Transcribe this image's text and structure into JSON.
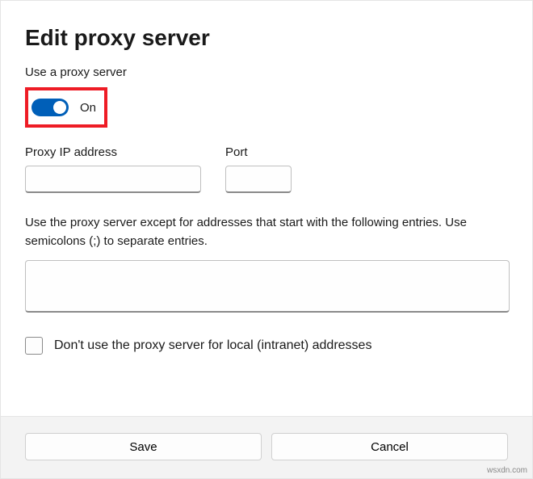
{
  "header": {
    "title": "Edit proxy server"
  },
  "toggle": {
    "label": "Use a proxy server",
    "state_label": "On"
  },
  "fields": {
    "ip_label": "Proxy IP address",
    "ip_value": "",
    "port_label": "Port",
    "port_value": ""
  },
  "exceptions": {
    "description": "Use the proxy server except for addresses that start with the following entries. Use semicolons (;) to separate entries.",
    "value": ""
  },
  "checkbox": {
    "label": "Don't use the proxy server for local (intranet) addresses",
    "checked": false
  },
  "footer": {
    "save": "Save",
    "cancel": "Cancel"
  },
  "watermark": "wsxdn.com",
  "colors": {
    "accent": "#005fb8",
    "highlight": "#ee1c25"
  }
}
